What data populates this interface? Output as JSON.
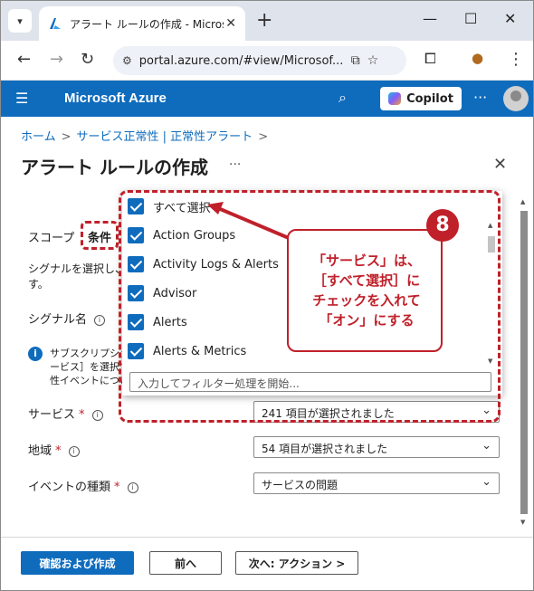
{
  "browser": {
    "tab_title": "アラート ルールの作成 - Microsoft A",
    "url": "portal.azure.com/#view/Microsof..."
  },
  "azure": {
    "brand": "Microsoft Azure",
    "copilot_label": "Copilot"
  },
  "breadcrumb": {
    "home": "ホーム",
    "service_health": "サービス正常性 | 正常性アラート",
    "separator": ">"
  },
  "page": {
    "title": "アラート ルールの作成",
    "tabs": {
      "scope": "スコープ",
      "condition": "条件"
    },
    "description_line1": "シグナルを選択し、そ",
    "description_line2": "す。",
    "signal_label": "シグナル名",
    "info_line1": "サブスクリプション",
    "info_line2": "ービス］を選択す",
    "info_line3": "性イベントについ"
  },
  "form": {
    "service_label": "サービス",
    "service_value": "241 項目が選択されました",
    "region_label": "地域",
    "region_value": "54 項目が選択されました",
    "event_type_label": "イベントの種類",
    "event_type_value": "サービスの問題"
  },
  "dropdown": {
    "options": [
      "すべて選択",
      "Action Groups",
      "Activity Logs & Alerts",
      "Advisor",
      "Alerts",
      "Alerts & Metrics"
    ],
    "filter_placeholder": "入力してフィルター処理を開始..."
  },
  "annotation": {
    "badge": "8",
    "line1": "「サービス」は、",
    "line2": "［すべて選択］に",
    "line3": "チェックを入れて",
    "line4": "「オン」にする"
  },
  "footer": {
    "review_create": "確認および作成",
    "previous": "前へ",
    "next": "次へ: アクション >"
  },
  "colors": {
    "accent": "#0f6cbd",
    "annotation": "#c0202a"
  }
}
